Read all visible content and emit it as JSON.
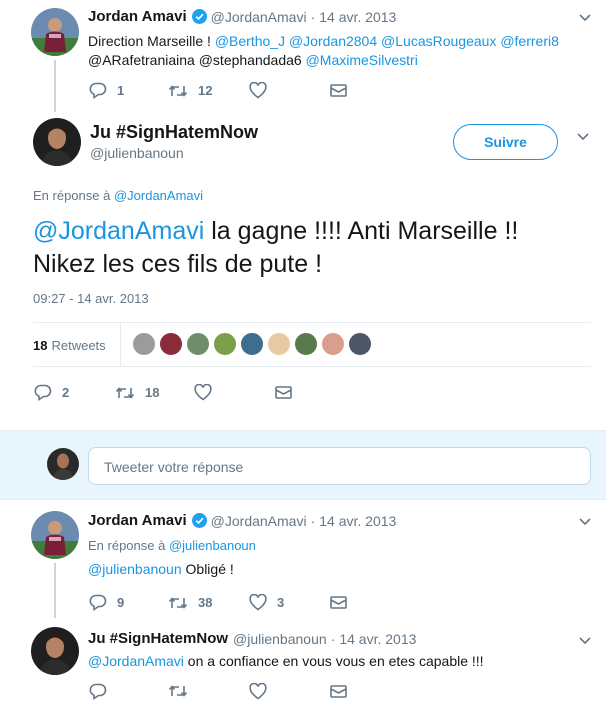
{
  "tweet1": {
    "name": "Jordan Amavi",
    "handle": "@JordanAmavi",
    "dot": "·",
    "date": "14 avr. 2013",
    "text_start": "Direction Marseille ! ",
    "mention1": "@Bertho_J",
    "mention2": "@Jordan2804",
    "mention3": "@LucasRougeaux",
    "mention4": "@ferreri8",
    "line2_plain": "@ARafetraniaina @stephandada6 ",
    "mention5": "@MaximeSilvestri",
    "replies": "1",
    "retweets": "12"
  },
  "main": {
    "name": "Ju #SignHatemNow",
    "handle": "@julienbanoun",
    "follow_label": "Suivre",
    "reply_to_prefix": "En réponse à ",
    "reply_to_handle": "@JordanAmavi",
    "mention": "@JordanAmavi",
    "text_rest": " la gagne !!!! Anti Marseille !!",
    "text_line2": "Nikez les ces fils de pute !",
    "timestamp": "09:27 - 14 avr. 2013",
    "retweet_count": "18",
    "retweet_label": "Retweets",
    "replies": "2",
    "retweets": "18"
  },
  "reply_box": {
    "placeholder": "Tweeter votre réponse"
  },
  "tweet2": {
    "name": "Jordan Amavi",
    "handle": "@JordanAmavi",
    "dot": "·",
    "date": "14 avr. 2013",
    "reply_to_prefix": "En réponse à ",
    "reply_to_handle": "@julienbanoun",
    "mention": "@julienbanoun",
    "text": " Obligé !",
    "replies": "9",
    "retweets": "38",
    "likes": "3"
  },
  "tweet3": {
    "name": "Ju #SignHatemNow",
    "handle": "@julienbanoun",
    "dot": "·",
    "date": "14 avr. 2013",
    "mention": "@JordanAmavi",
    "text": " on a confiance en vous vous en etes capable !!!"
  },
  "colors": {
    "accent": "#1b95e0",
    "verified": "#1da1f2",
    "divider": "#e6ecf0",
    "thread_line": "#ccd6dd"
  }
}
